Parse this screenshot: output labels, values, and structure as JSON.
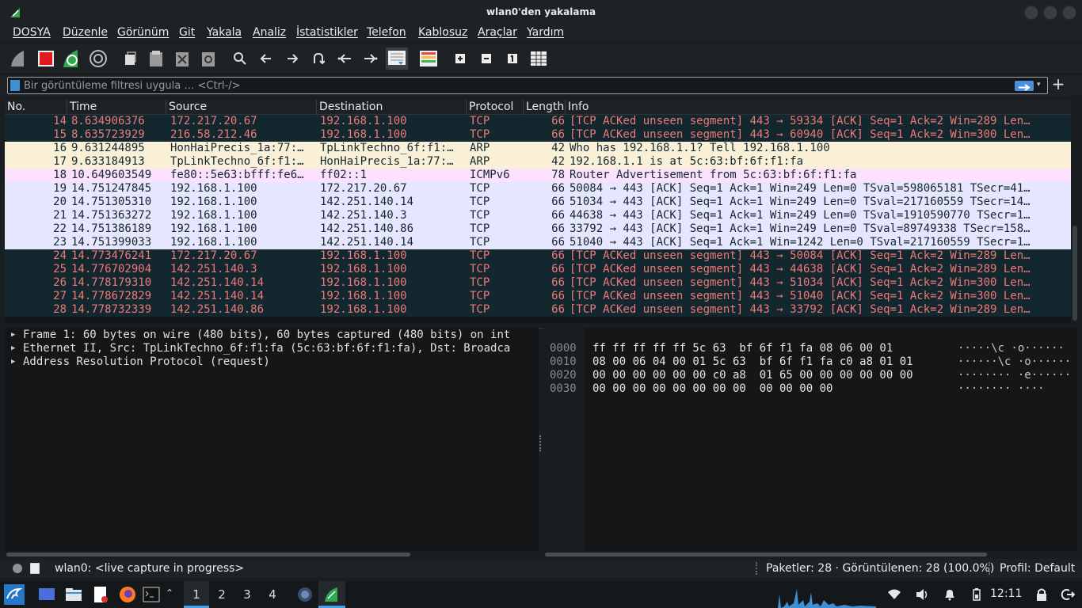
{
  "window": {
    "title": "wlan0'den yakalama"
  },
  "menu": [
    "DOSYA",
    "Düzenle",
    "Görünüm",
    "Git",
    "Yakala",
    "Analiz",
    "İstatistikler",
    "Telefon",
    "Kablosuz",
    "Araçlar",
    "Yardım"
  ],
  "toolbar": {
    "buttons": [
      "start-capture-icon",
      "stop-capture-icon",
      "restart-capture-icon",
      "capture-options-icon",
      "open-file-icon",
      "save-file-icon",
      "close-file-icon",
      "reload-file-icon",
      "find-packet-icon",
      "go-back-icon",
      "go-forward-icon",
      "go-to-packet-icon",
      "first-packet-icon",
      "last-packet-icon",
      "autoscroll-icon",
      "colorize-icon",
      "zoom-in-icon",
      "zoom-out-icon",
      "normal-size-icon",
      "resize-columns-icon"
    ]
  },
  "filter": {
    "placeholder": "Bir görüntüleme filtresi uygula … <Ctrl-/>",
    "value": "",
    "add_label": "+"
  },
  "columns": [
    "No.",
    "Time",
    "Source",
    "Destination",
    "Protocol",
    "Length",
    "Info"
  ],
  "packets": [
    {
      "no": "14",
      "time": "8.634906376",
      "src": "172.217.20.67",
      "dst": "192.168.1.100",
      "proto": "TCP",
      "len": "66",
      "info": "[TCP ACKed unseen segment] 443 → 59334 [ACK] Seq=1 Ack=2 Win=289 Len…",
      "cls": "tcp-bad"
    },
    {
      "no": "15",
      "time": "8.635723929",
      "src": "216.58.212.46",
      "dst": "192.168.1.100",
      "proto": "TCP",
      "len": "66",
      "info": "[TCP ACKed unseen segment] 443 → 60940 [ACK] Seq=1 Ack=2 Win=300 Len…",
      "cls": "tcp-bad"
    },
    {
      "no": "16",
      "time": "9.631244895",
      "src": "HonHaiPrecis_1a:77:…",
      "dst": "TpLinkTechno_6f:f1:…",
      "proto": "ARP",
      "len": "42",
      "info": "Who has 192.168.1.1? Tell 192.168.1.100",
      "cls": "arp"
    },
    {
      "no": "17",
      "time": "9.633184913",
      "src": "TpLinkTechno_6f:f1:…",
      "dst": "HonHaiPrecis_1a:77:…",
      "proto": "ARP",
      "len": "42",
      "info": "192.168.1.1 is at 5c:63:bf:6f:f1:fa",
      "cls": "arp"
    },
    {
      "no": "18",
      "time": "10.649603549",
      "src": "fe80::5e63:bfff:fe6…",
      "dst": "ff02::1",
      "proto": "ICMPv6",
      "len": "78",
      "info": "Router Advertisement from 5c:63:bf:6f:f1:fa",
      "cls": "icmp"
    },
    {
      "no": "19",
      "time": "14.751247845",
      "src": "192.168.1.100",
      "dst": "172.217.20.67",
      "proto": "TCP",
      "len": "66",
      "info": "50084 → 443 [ACK] Seq=1 Ack=1 Win=249 Len=0 TSval=598065181 TSecr=41…",
      "cls": "tcp"
    },
    {
      "no": "20",
      "time": "14.751305310",
      "src": "192.168.1.100",
      "dst": "142.251.140.14",
      "proto": "TCP",
      "len": "66",
      "info": "51034 → 443 [ACK] Seq=1 Ack=1 Win=249 Len=0 TSval=217160559 TSecr=14…",
      "cls": "tcp"
    },
    {
      "no": "21",
      "time": "14.751363272",
      "src": "192.168.1.100",
      "dst": "142.251.140.3",
      "proto": "TCP",
      "len": "66",
      "info": "44638 → 443 [ACK] Seq=1 Ack=1 Win=249 Len=0 TSval=1910590770 TSecr=1…",
      "cls": "tcp"
    },
    {
      "no": "22",
      "time": "14.751386189",
      "src": "192.168.1.100",
      "dst": "142.251.140.86",
      "proto": "TCP",
      "len": "66",
      "info": "33792 → 443 [ACK] Seq=1 Ack=1 Win=249 Len=0 TSval=89749338 TSecr=158…",
      "cls": "tcp"
    },
    {
      "no": "23",
      "time": "14.751399033",
      "src": "192.168.1.100",
      "dst": "142.251.140.14",
      "proto": "TCP",
      "len": "66",
      "info": "51040 → 443 [ACK] Seq=1 Ack=1 Win=1242 Len=0 TSval=217160559 TSecr=1…",
      "cls": "tcp"
    },
    {
      "no": "24",
      "time": "14.773476241",
      "src": "172.217.20.67",
      "dst": "192.168.1.100",
      "proto": "TCP",
      "len": "66",
      "info": "[TCP ACKed unseen segment] 443 → 50084 [ACK] Seq=1 Ack=2 Win=289 Len…",
      "cls": "tcp-bad"
    },
    {
      "no": "25",
      "time": "14.776702904",
      "src": "142.251.140.3",
      "dst": "192.168.1.100",
      "proto": "TCP",
      "len": "66",
      "info": "[TCP ACKed unseen segment] 443 → 44638 [ACK] Seq=1 Ack=2 Win=289 Len…",
      "cls": "tcp-bad"
    },
    {
      "no": "26",
      "time": "14.778179310",
      "src": "142.251.140.14",
      "dst": "192.168.1.100",
      "proto": "TCP",
      "len": "66",
      "info": "[TCP ACKed unseen segment] 443 → 51034 [ACK] Seq=1 Ack=2 Win=300 Len…",
      "cls": "tcp-bad"
    },
    {
      "no": "27",
      "time": "14.778672829",
      "src": "142.251.140.14",
      "dst": "192.168.1.100",
      "proto": "TCP",
      "len": "66",
      "info": "[TCP ACKed unseen segment] 443 → 51040 [ACK] Seq=1 Ack=2 Win=300 Len…",
      "cls": "tcp-bad"
    },
    {
      "no": "28",
      "time": "14.778732339",
      "src": "142.251.140.86",
      "dst": "192.168.1.100",
      "proto": "TCP",
      "len": "66",
      "info": "[TCP ACKed unseen segment] 443 → 33792 [ACK] Seq=1 Ack=2 Win=289 Len…",
      "cls": "tcp-bad"
    }
  ],
  "details": [
    "Frame 1: 60 bytes on wire (480 bits), 60 bytes captured (480 bits) on int",
    "Ethernet II, Src: TpLinkTechno_6f:f1:fa (5c:63:bf:6f:f1:fa), Dst: Broadca",
    "Address Resolution Protocol (request)"
  ],
  "bytes": [
    {
      "off": "0000",
      "hex": "ff ff ff ff ff 5c 63  bf 6f f1 fa 08 06 00 01",
      "ascii": "·····\\c ·o······"
    },
    {
      "off": "0010",
      "hex": "08 00 06 04 00 01 5c 63  bf 6f f1 fa c0 a8 01 01",
      "ascii": "······\\c ·o······"
    },
    {
      "off": "0020",
      "hex": "00 00 00 00 00 00 c0 a8  01 65 00 00 00 00 00 00",
      "ascii": "········ ·e······"
    },
    {
      "off": "0030",
      "hex": "00 00 00 00 00 00 00 00  00 00 00 00",
      "ascii": "········ ····"
    }
  ],
  "status": {
    "capture": "wlan0: <live capture in progress>",
    "packets": "Paketler: 28 · Görüntülenen: 28 (100.0%)",
    "profile": "Profil: Default"
  },
  "taskbar": {
    "workspaces": [
      "1",
      "2",
      "3",
      "4"
    ],
    "clock": "12:11"
  },
  "colors": {
    "tcp_bad_bg": "#12272e",
    "tcp_bad_fg": "#f27878",
    "arp_bg": "#faf0d7",
    "icmp_bg": "#fce0ff",
    "tcp_bg": "#e7e6ff",
    "accent": "#3d8fd6"
  }
}
